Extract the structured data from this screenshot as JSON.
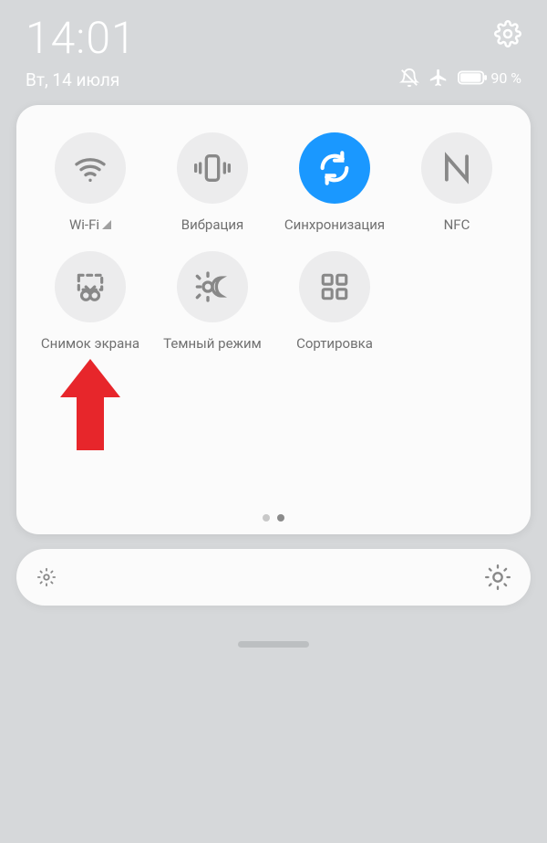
{
  "status": {
    "time": "14:01",
    "date": "Вт, 14 июля",
    "battery_percent": "90 %"
  },
  "tiles": {
    "wifi": {
      "label": "Wi-Fi"
    },
    "vibration": {
      "label": "Вибрация"
    },
    "sync": {
      "label": "Синхронизация"
    },
    "nfc": {
      "label": "NFC"
    },
    "screenshot": {
      "label": "Снимок экрана"
    },
    "dark": {
      "label": "Темный режим"
    },
    "sort": {
      "label": "Сортировка"
    }
  }
}
